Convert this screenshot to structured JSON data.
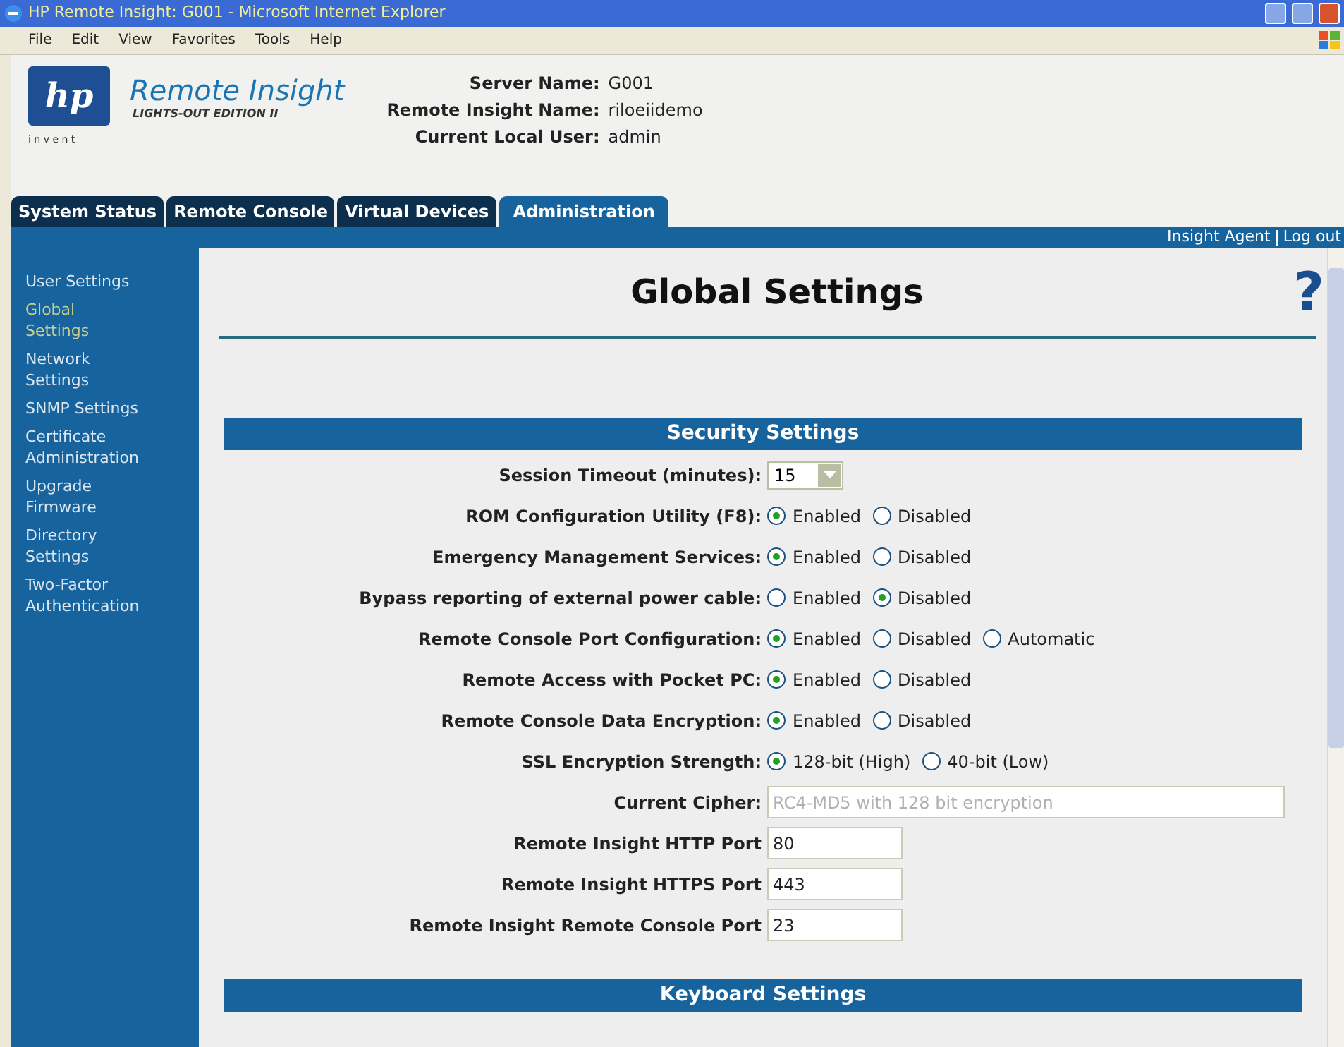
{
  "window": {
    "title": "HP Remote Insight: G001 - Microsoft Internet Explorer"
  },
  "menu": [
    "File",
    "Edit",
    "View",
    "Favorites",
    "Tools",
    "Help"
  ],
  "header": {
    "logo": "hp",
    "tagline": "i n v e n t",
    "product": "Remote Insight",
    "edition": "LIGHTS-OUT EDITION II",
    "info": [
      {
        "label": "Server Name:",
        "value": "G001"
      },
      {
        "label": "Remote Insight Name:",
        "value": "riloeiidemo"
      },
      {
        "label": "Current Local User:",
        "value": "admin"
      }
    ]
  },
  "tabs": [
    {
      "label": "System Status",
      "selected": false
    },
    {
      "label": "Remote Console",
      "selected": false
    },
    {
      "label": "Virtual Devices",
      "selected": false
    },
    {
      "label": "Administration",
      "selected": true
    }
  ],
  "top_links": [
    "Insight Agent",
    "Log out"
  ],
  "sidebar": {
    "items": [
      {
        "label": "User Settings",
        "selected": false
      },
      {
        "label": "Global Settings",
        "selected": true
      },
      {
        "label": "Network Settings",
        "selected": false
      },
      {
        "label": "SNMP Settings",
        "selected": false
      },
      {
        "label": "Certificate Administration",
        "selected": false
      },
      {
        "label": "Upgrade Firmware",
        "selected": false
      },
      {
        "label": "Directory Settings",
        "selected": false
      },
      {
        "label": "Two-Factor Authentication",
        "selected": false
      }
    ]
  },
  "page_title": "Global Settings",
  "help": "?",
  "sections": [
    {
      "title": "Security Settings",
      "rows": [
        {
          "kind": "select",
          "label": "Session Timeout (minutes):",
          "value": "15"
        },
        {
          "kind": "radio",
          "label": "ROM Configuration Utility (F8):",
          "options": [
            {
              "label": "Enabled",
              "selected": true
            },
            {
              "label": "Disabled",
              "selected": false
            }
          ]
        },
        {
          "kind": "radio",
          "label": "Emergency Management Services:",
          "options": [
            {
              "label": "Enabled",
              "selected": true
            },
            {
              "label": "Disabled",
              "selected": false
            }
          ]
        },
        {
          "kind": "radio",
          "label": "Bypass reporting of external power cable:",
          "options": [
            {
              "label": "Enabled",
              "selected": false
            },
            {
              "label": "Disabled",
              "selected": true
            }
          ]
        },
        {
          "kind": "radio",
          "label": "Remote Console Port Configuration:",
          "options": [
            {
              "label": "Enabled",
              "selected": true
            },
            {
              "label": "Disabled",
              "selected": false
            },
            {
              "label": "Automatic",
              "selected": false
            }
          ]
        },
        {
          "kind": "radio",
          "label": "Remote Access with Pocket PC:",
          "options": [
            {
              "label": "Enabled",
              "selected": true
            },
            {
              "label": "Disabled",
              "selected": false
            }
          ]
        },
        {
          "kind": "radio",
          "label": "Remote Console Data Encryption:",
          "options": [
            {
              "label": "Enabled",
              "selected": true
            },
            {
              "label": "Disabled",
              "selected": false
            }
          ]
        },
        {
          "kind": "radio",
          "label": "SSL Encryption Strength:",
          "options": [
            {
              "label": "128-bit (High)",
              "selected": true
            },
            {
              "label": "40-bit (Low)",
              "selected": false
            }
          ]
        },
        {
          "kind": "field",
          "label": "Current Cipher:",
          "value": "RC4-MD5 with 128 bit encryption",
          "disabled": true,
          "wide": true
        },
        {
          "kind": "field",
          "label": "Remote Insight HTTP Port",
          "value": "80",
          "disabled": false,
          "wide": false
        },
        {
          "kind": "field",
          "label": "Remote Insight HTTPS Port",
          "value": "443",
          "disabled": false,
          "wide": false
        },
        {
          "kind": "field",
          "label": "Remote Insight Remote Console Port",
          "value": "23",
          "disabled": false,
          "wide": false
        }
      ]
    },
    {
      "title": "Keyboard Settings"
    }
  ]
}
